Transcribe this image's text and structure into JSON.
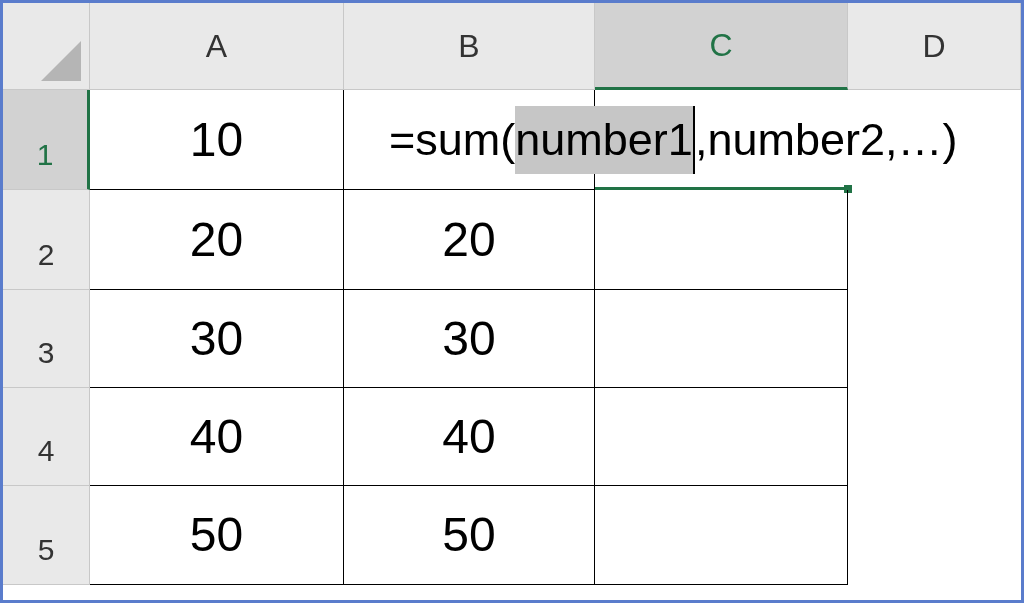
{
  "columns": [
    {
      "label": "A",
      "selected": false
    },
    {
      "label": "B",
      "selected": false
    },
    {
      "label": "C",
      "selected": true
    },
    {
      "label": "D",
      "selected": false
    }
  ],
  "rows": [
    {
      "header": "1",
      "selected": true,
      "cells": [
        "10",
        "",
        ""
      ]
    },
    {
      "header": "2",
      "selected": false,
      "cells": [
        "20",
        "20",
        ""
      ]
    },
    {
      "header": "3",
      "selected": false,
      "cells": [
        "30",
        "30",
        ""
      ]
    },
    {
      "header": "4",
      "selected": false,
      "cells": [
        "40",
        "40",
        ""
      ]
    },
    {
      "header": "5",
      "selected": false,
      "cells": [
        "50",
        "50",
        ""
      ]
    }
  ],
  "formula": {
    "prefix": "=sum(",
    "highlighted": "number1",
    "suffix": ",number2,…)"
  }
}
